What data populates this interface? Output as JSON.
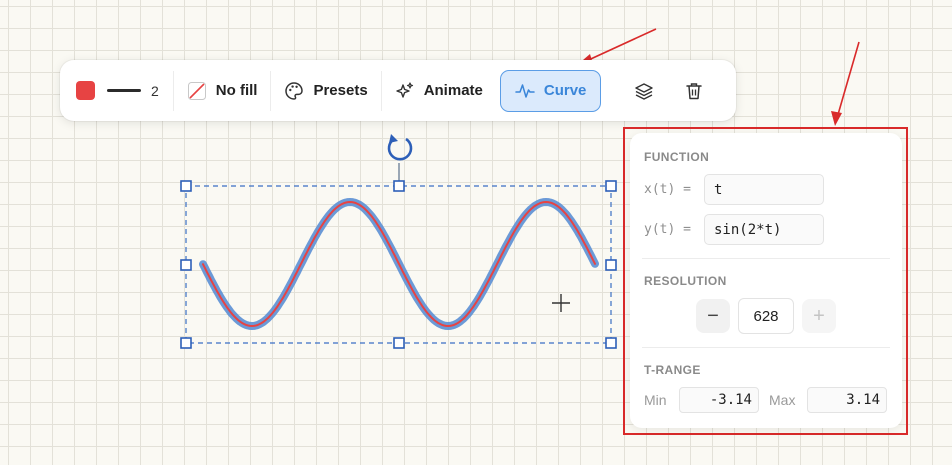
{
  "toolbar": {
    "stroke_color": "#e74343",
    "stroke_width": "2",
    "fill_label": "No fill",
    "presets_label": "Presets",
    "animate_label": "Animate",
    "curve_label": "Curve",
    "icons": [
      "color-swatch",
      "stroke-line",
      "no-fill-icon",
      "palette-icon",
      "sparkles-icon",
      "curve-icon",
      "layers-icon",
      "trash-icon"
    ]
  },
  "panel": {
    "function_title": "FUNCTION",
    "x_label": "x(t) =",
    "x_value": "t",
    "y_label": "y(t) =",
    "y_value": "sin(2*t)",
    "resolution_title": "RESOLUTION",
    "resolution_value": "628",
    "minus_symbol": "−",
    "plus_symbol": "+",
    "trange_title": "T-RANGE",
    "min_label": "Min",
    "min_value": "-3.14",
    "max_label": "Max",
    "max_value": "3.14"
  },
  "colors": {
    "accent": "#3a86d9",
    "curve_stroke": "#e74343",
    "curve_halo": "#5b8fd4",
    "highlight": "#d92a2a"
  }
}
